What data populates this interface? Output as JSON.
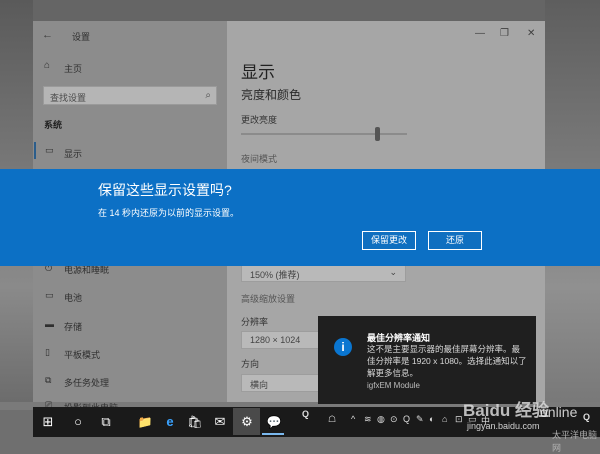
{
  "window": {
    "app_title": "设置",
    "controls": [
      "—",
      "❐",
      "✕"
    ]
  },
  "sidebar": {
    "home": "主页",
    "search_placeholder": "查找设置",
    "section": "系统",
    "items": [
      {
        "label": "显示",
        "icon": "monitor-icon"
      },
      {
        "label": "电源和睡眠",
        "icon": "power-icon"
      },
      {
        "label": "电池",
        "icon": "battery-icon"
      },
      {
        "label": "存储",
        "icon": "storage-icon"
      },
      {
        "label": "平板模式",
        "icon": "tablet-icon"
      },
      {
        "label": "多任务处理",
        "icon": "multitask-icon"
      },
      {
        "label": "投影到此电脑",
        "icon": "project-icon"
      }
    ]
  },
  "content": {
    "title": "显示",
    "section1": "亮度和颜色",
    "brightness_label": "更改亮度",
    "brightness_level": 0.82,
    "night_mode": "夜间模式",
    "scale_value": "150% (推荐)",
    "advanced_scaling": "高级缩放设置",
    "resolution_label": "分辨率",
    "resolution_value": "1280 × 1024",
    "orientation_label": "方向",
    "orientation_value": "横向"
  },
  "dialog": {
    "title": "保留这些显示设置吗?",
    "message": "在 14 秒内还原为以前的显示设置。",
    "keep_button": "保留更改",
    "revert_button": "还原"
  },
  "toast": {
    "title": "最佳分辨率通知",
    "body": "这不是主要显示器的最佳屏幕分辨率。最佳分辨率是 1920 x 1080。选择此通知以了解更多信息。",
    "app": "igfxEM Module"
  },
  "taskbar": {
    "start": "⊞",
    "search": "○",
    "task_view": "⧉",
    "apps": [
      "📁",
      "e",
      "🛍",
      "✉",
      "⚙",
      "💬"
    ],
    "tray_letter": "Q",
    "tray_icons": [
      "☖",
      "^",
      "≋",
      "◍",
      "⊙",
      "Q",
      "✎",
      "◐",
      "⌂",
      "⊡",
      "▭",
      "中"
    ],
    "notification_letter": "Q"
  },
  "watermark": {
    "logo": "Baidu 经验",
    "url": "jingyan.baidu.com",
    "tag": "online",
    "corner": "太平洋电脑网"
  },
  "colors": {
    "dialog_blue": "#0c70c5",
    "toast_bg": "#1f1f1f",
    "taskbar_bg": "#1a1a1a"
  }
}
